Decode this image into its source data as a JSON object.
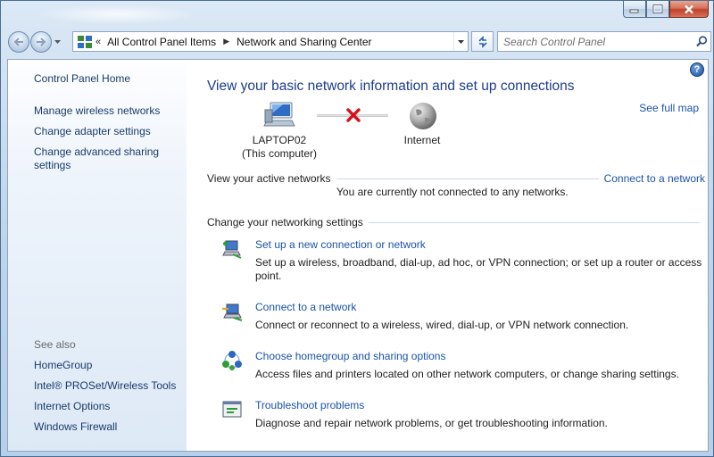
{
  "window": {
    "title": ""
  },
  "nav": {
    "breadcrumb": [
      "All Control Panel Items",
      "Network and Sharing Center"
    ],
    "search_placeholder": "Search Control Panel"
  },
  "sidebar": {
    "items": [
      {
        "label": "Control Panel Home"
      },
      {
        "label": "Manage wireless networks"
      },
      {
        "label": "Change adapter settings"
      },
      {
        "label": "Change advanced sharing settings"
      }
    ],
    "see_also_heading": "See also",
    "see_also": [
      {
        "label": "HomeGroup"
      },
      {
        "label": "Intel® PROSet/Wireless Tools"
      },
      {
        "label": "Internet Options"
      },
      {
        "label": "Windows Firewall"
      }
    ]
  },
  "main": {
    "heading": "View your basic network information and set up connections",
    "see_full_map": "See full map",
    "computer_name": "LAPTOP02",
    "computer_sub": "(This computer)",
    "internet_label": "Internet",
    "active_networks_label": "View your active networks",
    "connect_link": "Connect to a network",
    "not_connected": "You are currently not connected to any networks.",
    "settings_label": "Change your networking settings",
    "tasks": [
      {
        "title": "Set up a new connection or network",
        "desc": "Set up a wireless, broadband, dial-up, ad hoc, or VPN connection; or set up a router or access point.",
        "icon": "new-connection-icon"
      },
      {
        "title": "Connect to a network",
        "desc": "Connect or reconnect to a wireless, wired, dial-up, or VPN network connection.",
        "icon": "connect-network-icon"
      },
      {
        "title": "Choose homegroup and sharing options",
        "desc": "Access files and printers located on other network computers, or change sharing settings.",
        "icon": "homegroup-icon"
      },
      {
        "title": "Troubleshoot problems",
        "desc": "Diagnose and repair network problems, or get troubleshooting information.",
        "icon": "troubleshoot-icon"
      }
    ]
  },
  "colors": {
    "link": "#1a53a8",
    "heading": "#1e3c8c",
    "error": "#d4121b"
  }
}
